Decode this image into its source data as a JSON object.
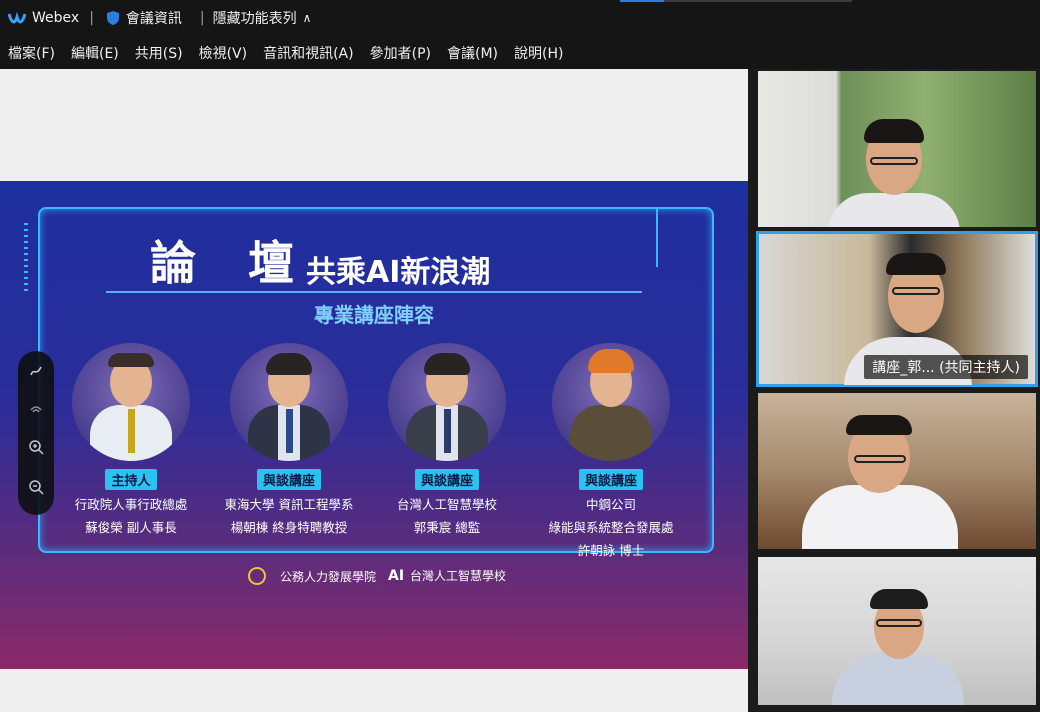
{
  "titlebar": {
    "app_name": "Webex",
    "meeting_info": "會議資訊",
    "hide_menu": "隱藏功能表列",
    "chevron": "∧",
    "progress_fraction": 0.19
  },
  "menubar": {
    "items": [
      "檔案(F)",
      "編輯(E)",
      "共用(S)",
      "檢視(V)",
      "音訊和視訊(A)",
      "參加者(P)",
      "會議(M)",
      "說明(H)"
    ]
  },
  "slide": {
    "title": "論 壇",
    "subtitle": "共乘AI新浪潮",
    "heading": "專業講座陣容",
    "speakers": [
      {
        "role": "主持人",
        "line1": "行政院人事行政總處",
        "line2": "蘇俊榮  副人事長",
        "line3": ""
      },
      {
        "role": "與談講座",
        "line1": "東海大學 資訊工程學系",
        "line2": "楊朝棟  終身特聘教授",
        "line3": ""
      },
      {
        "role": "與談講座",
        "line1": "台灣人工智慧學校",
        "line2": "郭秉宸  總監",
        "line3": ""
      },
      {
        "role": "與談講座",
        "line1": "中鋼公司",
        "line2": "綠能與系統整合發展處",
        "line3": "許朝詠  博士"
      }
    ],
    "logo_left": "公務人力發展學院",
    "logo_right": "台灣人工智慧學校"
  },
  "videos": {
    "tiles": [
      {
        "name": ""
      },
      {
        "name": "講座_郭... (共同主持人)"
      },
      {
        "name": ""
      },
      {
        "name": ""
      }
    ]
  },
  "colors": {
    "accent": "#2ea1e8",
    "slide_frame": "#3ab7ff",
    "role_badge": "#2cc2ef"
  }
}
